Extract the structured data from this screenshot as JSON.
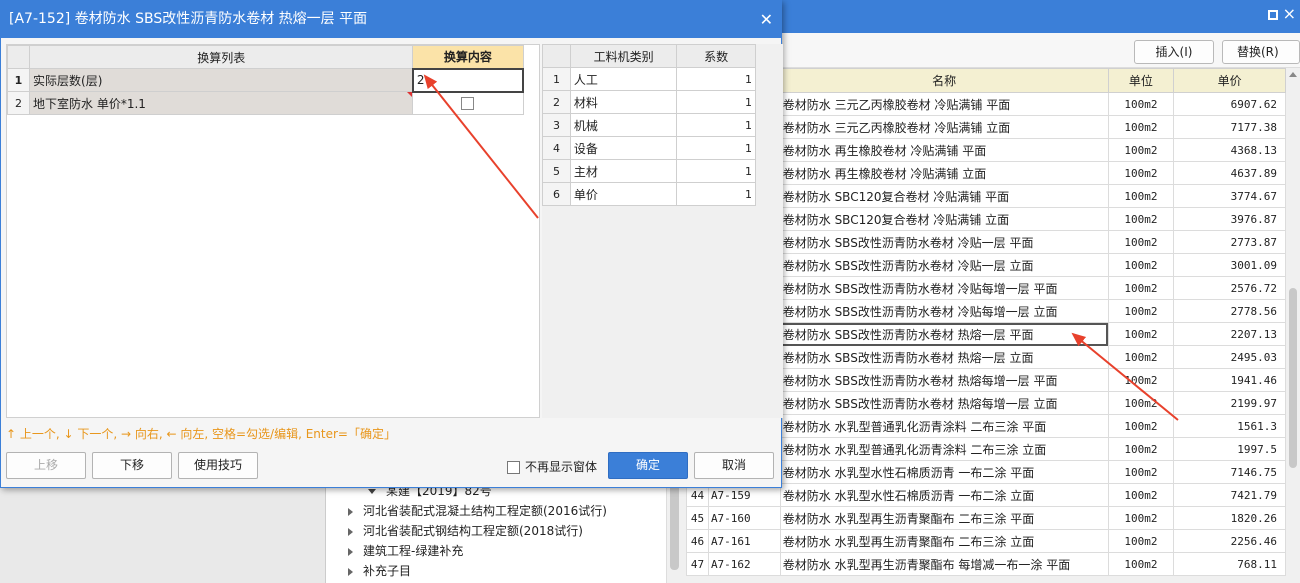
{
  "background": {
    "toolbar": {
      "insert_label": "插入(I)",
      "replace_label": "替换(R)"
    },
    "tree": [
      {
        "label": "某建【2019】82号",
        "level": 1
      },
      {
        "label": "河北省装配式混凝土结构工程定额(2016试行)",
        "level": 0
      },
      {
        "label": "河北省装配式钢结构工程定额(2018试行)",
        "level": 0
      },
      {
        "label": "建筑工程-绿建补充",
        "level": 0
      },
      {
        "label": "补充子目",
        "level": 0
      }
    ],
    "table": {
      "headers": {
        "name": "名称",
        "unit": "单位",
        "price": "单价"
      },
      "rows": [
        {
          "num": "",
          "code": "",
          "name": "卷材防水 三元乙丙橡胶卷材 冷贴满铺 平面",
          "unit": "100m2",
          "price": "6907.62"
        },
        {
          "num": "",
          "code": "",
          "name": "卷材防水 三元乙丙橡胶卷材 冷贴满铺 立面",
          "unit": "100m2",
          "price": "7177.38"
        },
        {
          "num": "",
          "code": "",
          "name": "卷材防水 再生橡胶卷材 冷贴满铺 平面",
          "unit": "100m2",
          "price": "4368.13"
        },
        {
          "num": "",
          "code": "",
          "name": "卷材防水 再生橡胶卷材 冷贴满铺 立面",
          "unit": "100m2",
          "price": "4637.89"
        },
        {
          "num": "",
          "code": "",
          "name": "卷材防水 SBC120复合卷材 冷贴满铺 平面",
          "unit": "100m2",
          "price": "3774.67"
        },
        {
          "num": "",
          "code": "",
          "name": "卷材防水 SBC120复合卷材 冷贴满铺 立面",
          "unit": "100m2",
          "price": "3976.87"
        },
        {
          "num": "",
          "code": "",
          "name": "卷材防水 SBS改性沥青防水卷材 冷贴一层 平面",
          "unit": "100m2",
          "price": "2773.87"
        },
        {
          "num": "",
          "code": "",
          "name": "卷材防水 SBS改性沥青防水卷材 冷贴一层 立面",
          "unit": "100m2",
          "price": "3001.09"
        },
        {
          "num": "",
          "code": "",
          "name": "卷材防水 SBS改性沥青防水卷材 冷贴每增一层 平面",
          "unit": "100m2",
          "price": "2576.72"
        },
        {
          "num": "",
          "code": "",
          "name": "卷材防水 SBS改性沥青防水卷材 冷贴每增一层 立面",
          "unit": "100m2",
          "price": "2778.56"
        },
        {
          "num": "",
          "code": "",
          "name": "卷材防水 SBS改性沥青防水卷材 热熔一层 平面",
          "unit": "100m2",
          "price": "2207.13",
          "selected": true
        },
        {
          "num": "",
          "code": "",
          "name": "卷材防水 SBS改性沥青防水卷材 热熔一层 立面",
          "unit": "100m2",
          "price": "2495.03"
        },
        {
          "num": "",
          "code": "",
          "name": "卷材防水 SBS改性沥青防水卷材 热熔每增一层 平面",
          "unit": "100m2",
          "price": "1941.46"
        },
        {
          "num": "",
          "code": "",
          "name": "卷材防水 SBS改性沥青防水卷材 热熔每增一层 立面",
          "unit": "100m2",
          "price": "2199.97"
        },
        {
          "num": "",
          "code": "",
          "name": "卷材防水 水乳型普通乳化沥青涂料 二布三涂 平面",
          "unit": "100m2",
          "price": "1561.3"
        },
        {
          "num": "",
          "code": "",
          "name": "卷材防水 水乳型普通乳化沥青涂料 二布三涂 立面",
          "unit": "100m2",
          "price": "1997.5"
        },
        {
          "num": "",
          "code": "",
          "name": "卷材防水 水乳型水性石棉质沥青 一布二涂 平面",
          "unit": "100m2",
          "price": "7146.75"
        },
        {
          "num": "44",
          "code": "A7-159",
          "name": "卷材防水 水乳型水性石棉质沥青 一布二涂 立面",
          "unit": "100m2",
          "price": "7421.79"
        },
        {
          "num": "45",
          "code": "A7-160",
          "name": "卷材防水 水乳型再生沥青聚酯布 二布三涂 平面",
          "unit": "100m2",
          "price": "1820.26"
        },
        {
          "num": "46",
          "code": "A7-161",
          "name": "卷材防水 水乳型再生沥青聚酯布 二布三涂 立面",
          "unit": "100m2",
          "price": "2256.46"
        },
        {
          "num": "47",
          "code": "A7-162",
          "name": "卷材防水 水乳型再生沥青聚酯布 每增减一布一涂 平面",
          "unit": "100m2",
          "price": "768.11"
        }
      ]
    }
  },
  "dialog": {
    "title": "[A7-152] 卷材防水 SBS改性沥青防水卷材 热熔一层 平面",
    "left_grid": {
      "headers": {
        "list": "换算列表",
        "content": "换算内容"
      },
      "rows": [
        {
          "num": "1",
          "label": "实际层数(层)",
          "value": "2"
        },
        {
          "num": "2",
          "label": "地下室防水 单价*1.1",
          "value": ""
        }
      ]
    },
    "right_grid": {
      "headers": {
        "category": "工料机类别",
        "coef": "系数"
      },
      "rows": [
        {
          "num": "1",
          "category": "人工",
          "coef": "1"
        },
        {
          "num": "2",
          "category": "材料",
          "coef": "1"
        },
        {
          "num": "3",
          "category": "机械",
          "coef": "1"
        },
        {
          "num": "4",
          "category": "设备",
          "coef": "1"
        },
        {
          "num": "5",
          "category": "主材",
          "coef": "1"
        },
        {
          "num": "6",
          "category": "单价",
          "coef": "1"
        }
      ]
    },
    "hint": "↑ 上一个, ↓ 下一个, → 向右, ← 向左, 空格=勾选/编辑, Enter=「确定」",
    "buttons": {
      "move_up": "上移",
      "move_down": "下移",
      "tips": "使用技巧",
      "no_show": "不再显示窗体",
      "ok": "确定",
      "cancel": "取消"
    }
  },
  "colors": {
    "accent": "#3b7fd8",
    "hint": "#e8961b",
    "annotation": "#e8412c",
    "header_highlight": "#fbe3a8"
  }
}
